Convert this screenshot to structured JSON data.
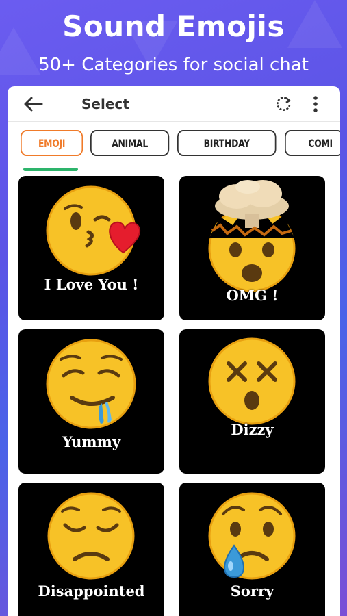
{
  "hero": {
    "title": "Sound Emojis",
    "subtitle": "50+ Categories for social chat"
  },
  "appbar": {
    "title": "Select",
    "back_icon": "arrow-left-icon",
    "refresh_icon": "refresh-icon",
    "more_icon": "more-vert-icon"
  },
  "tabs": [
    {
      "label": "EMOJI",
      "active": true
    },
    {
      "label": "ANIMAL",
      "active": false
    },
    {
      "label": "BIRTHDAY",
      "active": false
    },
    {
      "label": "COMI",
      "active": false
    }
  ],
  "cards": [
    {
      "label": "I Love You !",
      "emoji": "kissing-heart"
    },
    {
      "label": "OMG !",
      "emoji": "exploding-head"
    },
    {
      "label": "Yummy",
      "emoji": "drooling"
    },
    {
      "label": "Dizzy",
      "emoji": "dizzy"
    },
    {
      "label": "Disappointed",
      "emoji": "disappointed"
    },
    {
      "label": "Sorry",
      "emoji": "sad-tear"
    }
  ],
  "colors": {
    "active_tab": "#f07b2a",
    "indicator": "#2db46b",
    "card_bg": "#000000",
    "emoji_yellow": "#f7c227"
  }
}
